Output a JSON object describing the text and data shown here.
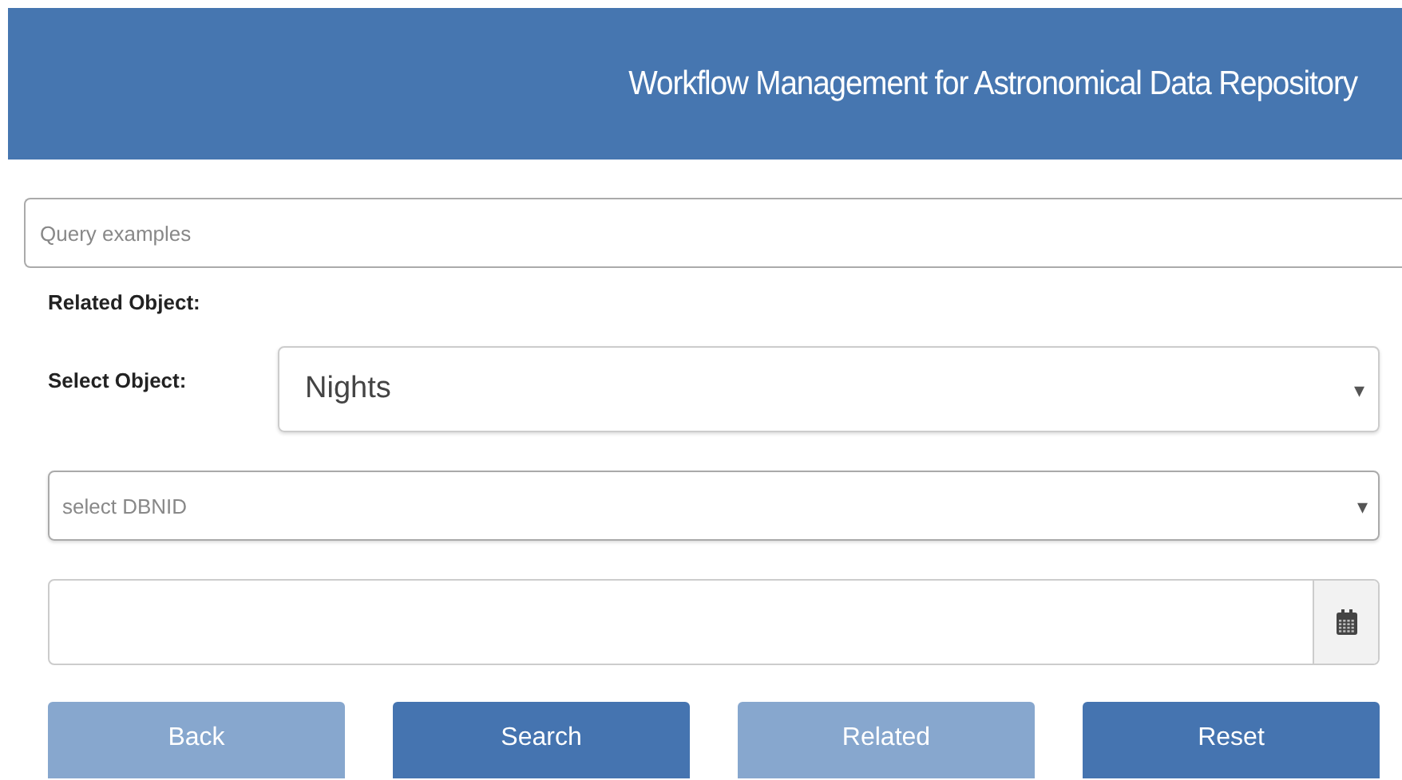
{
  "header": {
    "title": "Workflow Management for Astronomical Data Repository"
  },
  "query_field": {
    "placeholder": "Query examples"
  },
  "related_object_label": "Related Object:",
  "select_object": {
    "label": "Select Object:",
    "value": "Nights",
    "arrow": "▾"
  },
  "dbnid_select": {
    "placeholder": "select DBNID",
    "arrow": "▾"
  },
  "buttons": [
    {
      "label": "Back",
      "disabled": true
    },
    {
      "label": "Search",
      "disabled": false
    },
    {
      "label": "Related",
      "disabled": true
    },
    {
      "label": "Reset",
      "disabled": false
    }
  ]
}
